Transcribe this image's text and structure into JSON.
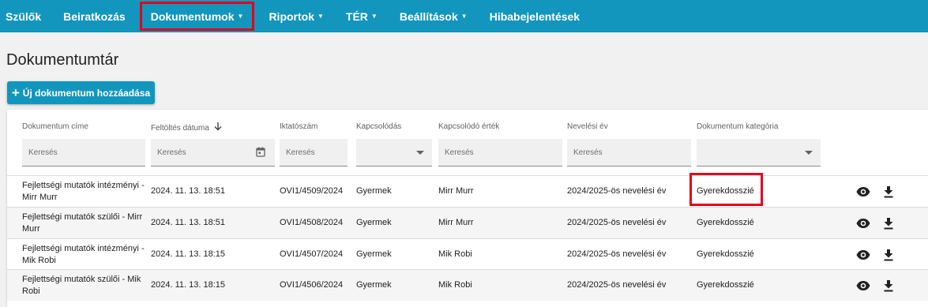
{
  "nav": {
    "items": [
      {
        "label": "Szülők",
        "caret": false,
        "highlighted": false
      },
      {
        "label": "Beiratkozás",
        "caret": false,
        "highlighted": false
      },
      {
        "label": "Dokumentumok",
        "caret": true,
        "highlighted": true
      },
      {
        "label": "Riportok",
        "caret": true,
        "highlighted": false
      },
      {
        "label": "TÉR",
        "caret": true,
        "highlighted": false
      },
      {
        "label": "Beállítások",
        "caret": true,
        "highlighted": false
      },
      {
        "label": "Hibabejelentések",
        "caret": false,
        "highlighted": false
      }
    ],
    "caret_glyph": "▼"
  },
  "page": {
    "title": "Dokumentumtár",
    "add_button_label": "Új dokumentum hozzáadása",
    "add_button_icon": "plus-icon"
  },
  "table": {
    "columns": [
      {
        "label": "Dokumentum címe",
        "filter": "text",
        "placeholder": "Keresés"
      },
      {
        "label": "Feltöltés dátuma",
        "filter": "date",
        "placeholder": "Keresés",
        "sort": "desc"
      },
      {
        "label": "Iktatószám",
        "filter": "text",
        "placeholder": "Keresés"
      },
      {
        "label": "Kapcsolódás",
        "filter": "select",
        "placeholder": ""
      },
      {
        "label": "Kapcsolódó érték",
        "filter": "text",
        "placeholder": "Keresés"
      },
      {
        "label": "Nevelési év",
        "filter": "text",
        "placeholder": "Keresés"
      },
      {
        "label": "Dokumentum kategória",
        "filter": "select",
        "placeholder": ""
      }
    ],
    "rows": [
      {
        "title": "Fejlettségi mutatók intézményi - Mirr Murr",
        "date": "2024. 11. 13. 18:51",
        "ref": "OVI1/4509/2024",
        "link": "Gyermek",
        "link_value": "Mirr Murr",
        "year": "2024/2025-ös nevelési év",
        "category": "Gyerekdosszié",
        "category_highlighted": true
      },
      {
        "title": "Fejlettségi mutatók szülői - Mirr Murr",
        "date": "2024. 11. 13. 18:51",
        "ref": "OVI1/4508/2024",
        "link": "Gyermek",
        "link_value": "Mirr Murr",
        "year": "2024/2025-ös nevelési év",
        "category": "Gyerekdosszié",
        "category_highlighted": false
      },
      {
        "title": "Fejlettségi mutatók intézményi - Mik Robi",
        "date": "2024. 11. 13. 18:15",
        "ref": "OVI1/4507/2024",
        "link": "Gyermek",
        "link_value": "Mik Robi",
        "year": "2024/2025-ös nevelési év",
        "category": "Gyerekdosszié",
        "category_highlighted": false
      },
      {
        "title": "Fejlettségi mutatók szülői - Mik Robi",
        "date": "2024. 11. 13. 18:15",
        "ref": "OVI1/4506/2024",
        "link": "Gyermek",
        "link_value": "Mik Robi",
        "year": "2024/2025-ös nevelési év",
        "category": "Gyerekdosszié",
        "category_highlighted": false
      }
    ]
  },
  "colors": {
    "nav_bg": "#1396bd",
    "highlight": "#e3001b",
    "page_bg": "#f1f1f1"
  }
}
